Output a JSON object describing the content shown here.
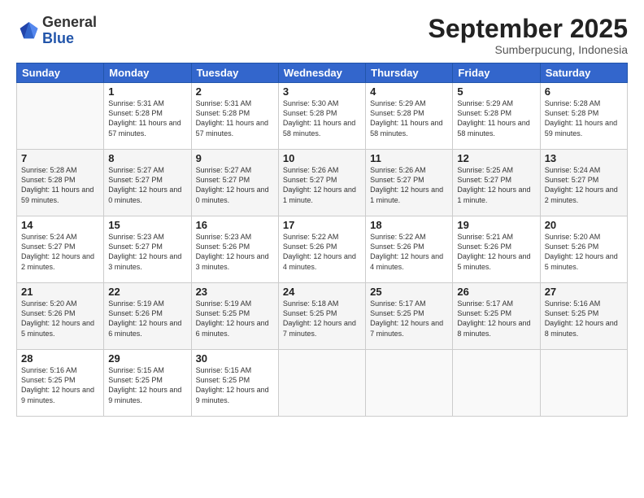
{
  "header": {
    "logo_general": "General",
    "logo_blue": "Blue",
    "month": "September 2025",
    "location": "Sumberpucung, Indonesia"
  },
  "days_of_week": [
    "Sunday",
    "Monday",
    "Tuesday",
    "Wednesday",
    "Thursday",
    "Friday",
    "Saturday"
  ],
  "weeks": [
    [
      {
        "day": "",
        "info": ""
      },
      {
        "day": "1",
        "info": "Sunrise: 5:31 AM\nSunset: 5:28 PM\nDaylight: 11 hours\nand 57 minutes."
      },
      {
        "day": "2",
        "info": "Sunrise: 5:31 AM\nSunset: 5:28 PM\nDaylight: 11 hours\nand 57 minutes."
      },
      {
        "day": "3",
        "info": "Sunrise: 5:30 AM\nSunset: 5:28 PM\nDaylight: 11 hours\nand 58 minutes."
      },
      {
        "day": "4",
        "info": "Sunrise: 5:29 AM\nSunset: 5:28 PM\nDaylight: 11 hours\nand 58 minutes."
      },
      {
        "day": "5",
        "info": "Sunrise: 5:29 AM\nSunset: 5:28 PM\nDaylight: 11 hours\nand 58 minutes."
      },
      {
        "day": "6",
        "info": "Sunrise: 5:28 AM\nSunset: 5:28 PM\nDaylight: 11 hours\nand 59 minutes."
      }
    ],
    [
      {
        "day": "7",
        "info": "Sunrise: 5:28 AM\nSunset: 5:28 PM\nDaylight: 11 hours\nand 59 minutes."
      },
      {
        "day": "8",
        "info": "Sunrise: 5:27 AM\nSunset: 5:27 PM\nDaylight: 12 hours\nand 0 minutes."
      },
      {
        "day": "9",
        "info": "Sunrise: 5:27 AM\nSunset: 5:27 PM\nDaylight: 12 hours\nand 0 minutes."
      },
      {
        "day": "10",
        "info": "Sunrise: 5:26 AM\nSunset: 5:27 PM\nDaylight: 12 hours\nand 1 minute."
      },
      {
        "day": "11",
        "info": "Sunrise: 5:26 AM\nSunset: 5:27 PM\nDaylight: 12 hours\nand 1 minute."
      },
      {
        "day": "12",
        "info": "Sunrise: 5:25 AM\nSunset: 5:27 PM\nDaylight: 12 hours\nand 1 minute."
      },
      {
        "day": "13",
        "info": "Sunrise: 5:24 AM\nSunset: 5:27 PM\nDaylight: 12 hours\nand 2 minutes."
      }
    ],
    [
      {
        "day": "14",
        "info": "Sunrise: 5:24 AM\nSunset: 5:27 PM\nDaylight: 12 hours\nand 2 minutes."
      },
      {
        "day": "15",
        "info": "Sunrise: 5:23 AM\nSunset: 5:27 PM\nDaylight: 12 hours\nand 3 minutes."
      },
      {
        "day": "16",
        "info": "Sunrise: 5:23 AM\nSunset: 5:26 PM\nDaylight: 12 hours\nand 3 minutes."
      },
      {
        "day": "17",
        "info": "Sunrise: 5:22 AM\nSunset: 5:26 PM\nDaylight: 12 hours\nand 4 minutes."
      },
      {
        "day": "18",
        "info": "Sunrise: 5:22 AM\nSunset: 5:26 PM\nDaylight: 12 hours\nand 4 minutes."
      },
      {
        "day": "19",
        "info": "Sunrise: 5:21 AM\nSunset: 5:26 PM\nDaylight: 12 hours\nand 5 minutes."
      },
      {
        "day": "20",
        "info": "Sunrise: 5:20 AM\nSunset: 5:26 PM\nDaylight: 12 hours\nand 5 minutes."
      }
    ],
    [
      {
        "day": "21",
        "info": "Sunrise: 5:20 AM\nSunset: 5:26 PM\nDaylight: 12 hours\nand 5 minutes."
      },
      {
        "day": "22",
        "info": "Sunrise: 5:19 AM\nSunset: 5:26 PM\nDaylight: 12 hours\nand 6 minutes."
      },
      {
        "day": "23",
        "info": "Sunrise: 5:19 AM\nSunset: 5:25 PM\nDaylight: 12 hours\nand 6 minutes."
      },
      {
        "day": "24",
        "info": "Sunrise: 5:18 AM\nSunset: 5:25 PM\nDaylight: 12 hours\nand 7 minutes."
      },
      {
        "day": "25",
        "info": "Sunrise: 5:17 AM\nSunset: 5:25 PM\nDaylight: 12 hours\nand 7 minutes."
      },
      {
        "day": "26",
        "info": "Sunrise: 5:17 AM\nSunset: 5:25 PM\nDaylight: 12 hours\nand 8 minutes."
      },
      {
        "day": "27",
        "info": "Sunrise: 5:16 AM\nSunset: 5:25 PM\nDaylight: 12 hours\nand 8 minutes."
      }
    ],
    [
      {
        "day": "28",
        "info": "Sunrise: 5:16 AM\nSunset: 5:25 PM\nDaylight: 12 hours\nand 9 minutes."
      },
      {
        "day": "29",
        "info": "Sunrise: 5:15 AM\nSunset: 5:25 PM\nDaylight: 12 hours\nand 9 minutes."
      },
      {
        "day": "30",
        "info": "Sunrise: 5:15 AM\nSunset: 5:25 PM\nDaylight: 12 hours\nand 9 minutes."
      },
      {
        "day": "",
        "info": ""
      },
      {
        "day": "",
        "info": ""
      },
      {
        "day": "",
        "info": ""
      },
      {
        "day": "",
        "info": ""
      }
    ]
  ]
}
